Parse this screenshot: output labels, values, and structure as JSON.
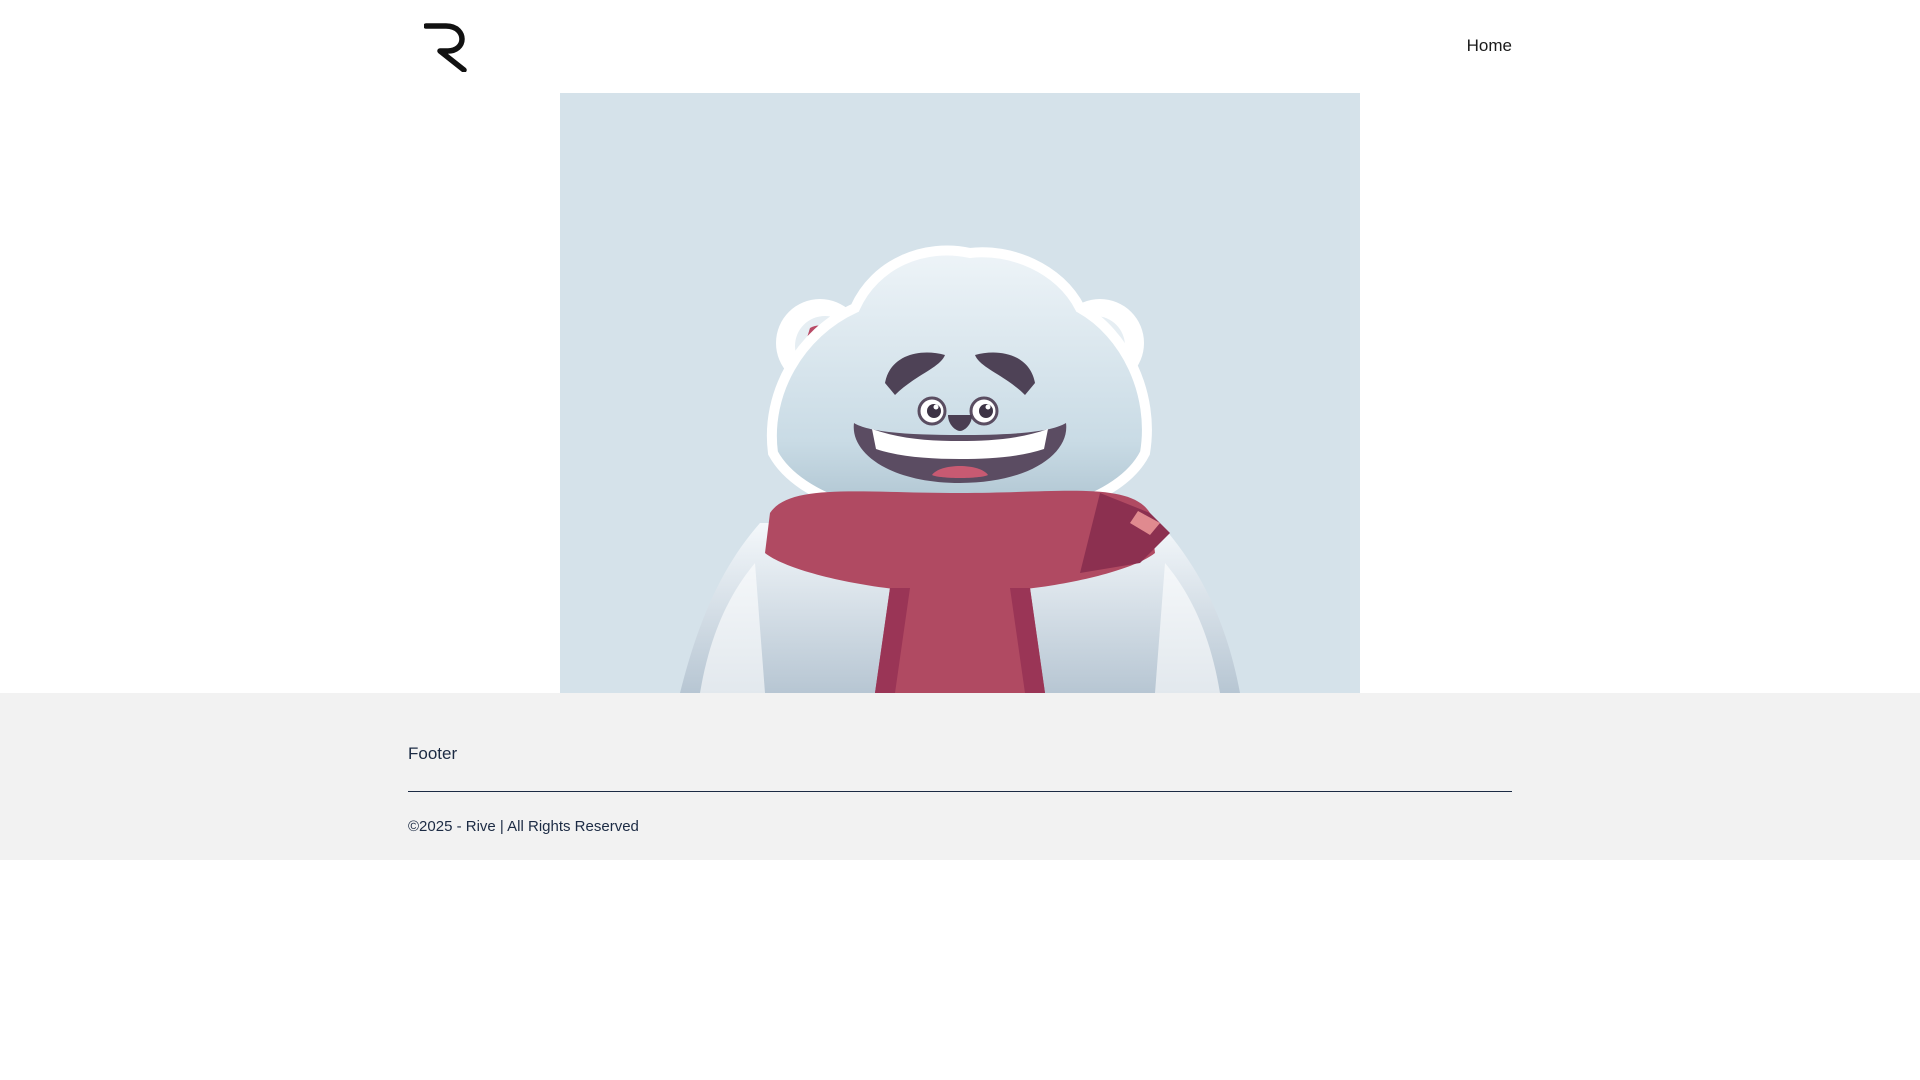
{
  "header": {
    "logo_icon": "rive-r-logo-icon",
    "nav": {
      "home_label": "Home"
    }
  },
  "hero": {
    "image_icon": "polar-bear-scarf-illustration",
    "background_color": "#d5e2ea",
    "scarf_color": "#b04a62"
  },
  "footer": {
    "heading": "Footer",
    "copyright": "©2025 - Rive | All Rights Reserved",
    "background_color": "#f2f2f2",
    "text_color": "#1c2b44"
  }
}
